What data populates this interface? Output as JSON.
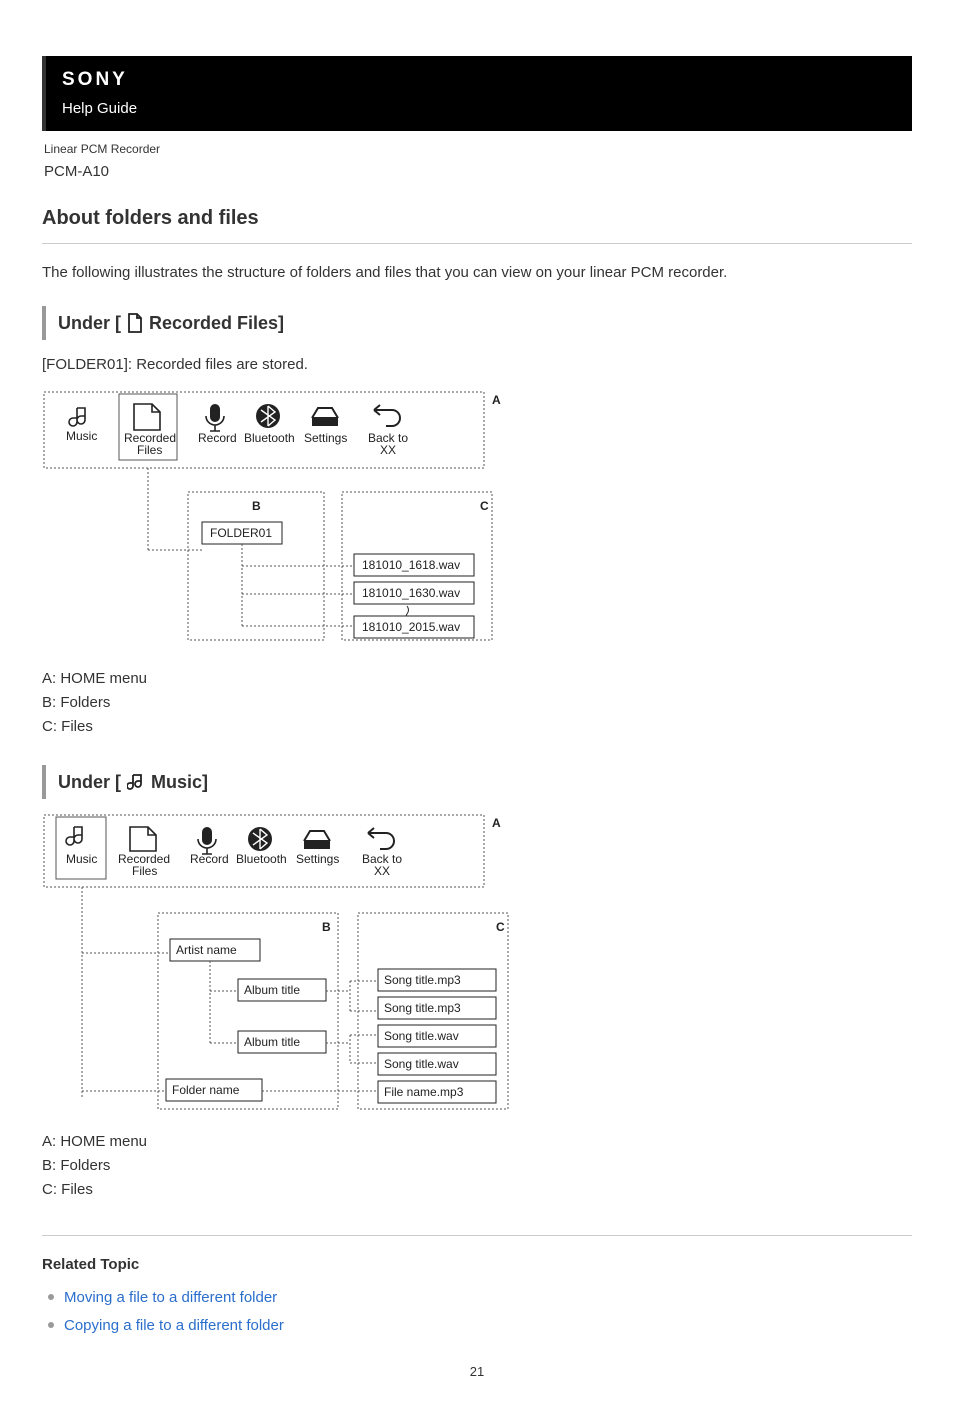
{
  "header": {
    "brand": "SONY",
    "subtitle": "Help Guide",
    "device_caption": "Linear PCM Recorder",
    "model": "PCM-A10"
  },
  "title": "About folders and files",
  "intro": "The following illustrates the structure of folders and files that you can view on your linear PCM recorder.",
  "section1": {
    "prefix": "Under [",
    "suffix": " Recorded Files]",
    "folder_text": "[FOLDER01]: Recorded files are stored.",
    "menu_items": [
      "Music",
      "Recorded Files",
      "Record",
      "Bluetooth",
      "Settings",
      "Back to XX"
    ],
    "label_A": "A",
    "label_B": "B",
    "label_C": "C",
    "folders": [
      "FOLDER01"
    ],
    "files": [
      "181010_1618.wav",
      "181010_1630.wav",
      "181010_2015.wav"
    ],
    "legend": {
      "A": "A: HOME menu",
      "B": "B: Folders",
      "C": "C: Files"
    }
  },
  "section2": {
    "prefix": "Under [",
    "suffix": " Music]",
    "menu_items": [
      "Music",
      "Recorded Files",
      "Record",
      "Bluetooth",
      "Settings",
      "Back to XX"
    ],
    "label_A": "A",
    "label_B": "B",
    "label_C": "C",
    "artist": "Artist name",
    "albums": [
      "Album title",
      "Album title"
    ],
    "extra_folder": "Folder name",
    "files": [
      "Song title.mp3",
      "Song title.mp3",
      "Song title.wav",
      "Song title.wav",
      "File name.mp3"
    ],
    "legend": {
      "A": "A: HOME menu",
      "B": "B: Folders",
      "C": "C: Files"
    }
  },
  "related": {
    "heading": "Related Topic",
    "links": [
      "Moving a file to a different folder",
      "Copying a file to a different folder"
    ]
  },
  "page_number": "21"
}
